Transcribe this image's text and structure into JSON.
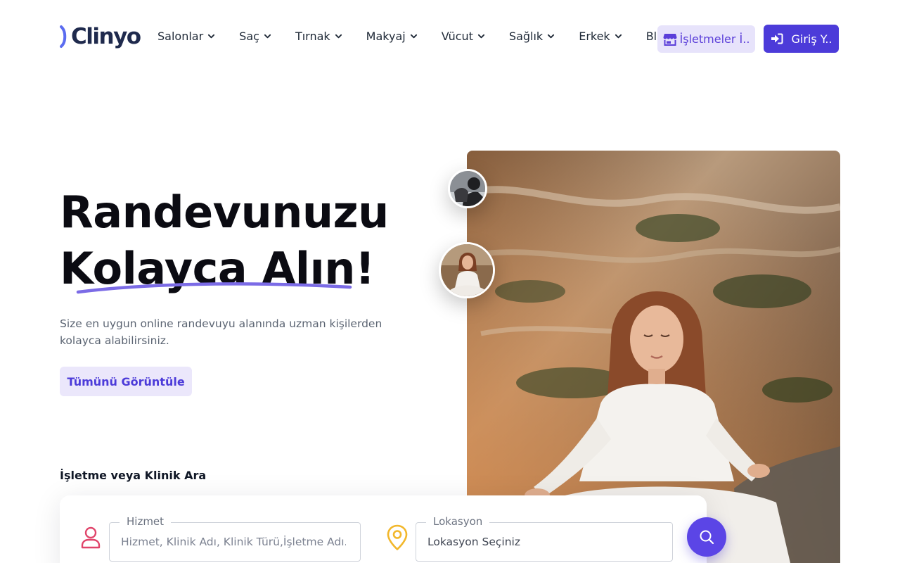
{
  "brand": {
    "name": "Clinyo",
    "accent": "#4c3bd9",
    "logo_mark_color": "#5b6cf0"
  },
  "nav": {
    "items": [
      {
        "label": "Salonlar",
        "dropdown": true
      },
      {
        "label": "Saç",
        "dropdown": true
      },
      {
        "label": "Tırnak",
        "dropdown": true
      },
      {
        "label": "Makyaj",
        "dropdown": true
      },
      {
        "label": "Vücut",
        "dropdown": true
      },
      {
        "label": "Sağlık",
        "dropdown": true
      },
      {
        "label": "Erkek",
        "dropdown": true
      },
      {
        "label": "Blog",
        "dropdown": false
      }
    ],
    "business_button": "İşletmeler İ..",
    "login_button": "Giriş Y.."
  },
  "hero": {
    "title_line1": "Randevunuzu",
    "title_line2": "Kolayca Alın!",
    "description": "Size en uygun online randevuyu alanında uzman kişilerden kolayca alabilirsiniz.",
    "cta": "Tümünü Görüntüle"
  },
  "search": {
    "heading": "İşletme veya Klinik Ara",
    "service": {
      "label": "Hizmet",
      "placeholder": "Hizmet, Klinik Adı, Klinik Türü,İşletme Adı..."
    },
    "location": {
      "label": "Lokasyon",
      "placeholder": "Lokasyon Seçiniz"
    }
  },
  "icons": {
    "nav_chevron": "chevron-down-icon",
    "business": "store-icon",
    "login": "sign-in-icon",
    "service": "user-icon",
    "location": "map-pin-icon",
    "search": "search-icon"
  }
}
